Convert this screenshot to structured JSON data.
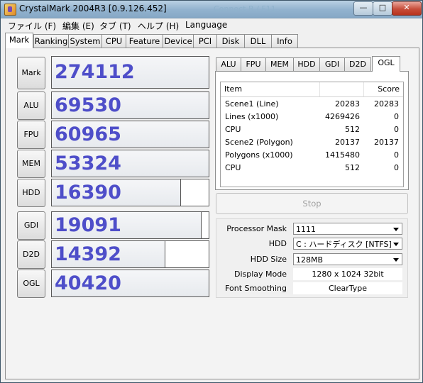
{
  "window": {
    "title": "CrystalMark 2004R3 [0.9.126.452]",
    "background_ghost_title": "Connect R / F11 ...",
    "min_glyph": "—",
    "max_glyph": "□",
    "close_glyph": "✕"
  },
  "menu": [
    "ファイル (F)",
    "編集 (E)",
    "タブ (T)",
    "ヘルプ (H)",
    "Language"
  ],
  "tabs": [
    "Mark",
    "Ranking",
    "System",
    "CPU",
    "Feature",
    "Device",
    "PCI",
    "Disk",
    "DLL",
    "Info"
  ],
  "active_tab": "Mark",
  "scores": {
    "mark": {
      "label": "Mark",
      "value": "274112",
      "fill": 1.0
    },
    "alu": {
      "label": "ALU",
      "value": "69530",
      "fill": 1.0
    },
    "fpu": {
      "label": "FPU",
      "value": "60965",
      "fill": 1.0
    },
    "mem": {
      "label": "MEM",
      "value": "53324",
      "fill": 1.0
    },
    "hdd": {
      "label": "HDD",
      "value": "16390",
      "fill": 0.82
    },
    "gdi": {
      "label": "GDI",
      "value": "19091",
      "fill": 0.95
    },
    "d2d": {
      "label": "D2D",
      "value": "14392",
      "fill": 0.72
    },
    "ogl": {
      "label": "OGL",
      "value": "40420",
      "fill": 1.0
    }
  },
  "subtabs": [
    "ALU",
    "FPU",
    "MEM",
    "HDD",
    "GDI",
    "D2D",
    "OGL"
  ],
  "active_subtab": "OGL",
  "results": {
    "columns": [
      "Item",
      "",
      "Score"
    ],
    "rows": [
      [
        "Scene1 (Line)",
        "20283",
        "20283"
      ],
      [
        "Lines (x1000)",
        "4269426",
        "0"
      ],
      [
        "CPU",
        "512",
        "0"
      ],
      [
        "Scene2 (Polygon)",
        "20137",
        "20137"
      ],
      [
        "Polygons (x1000)",
        "1415480",
        "0"
      ],
      [
        "CPU",
        "512",
        "0"
      ]
    ]
  },
  "stop_button": "Stop",
  "settings": {
    "processor_mask_label": "Processor Mask",
    "processor_mask_value": "1111",
    "hdd_label": "HDD",
    "hdd_value": "C : ハードディスク [NTFS]",
    "hdd_size_label": "HDD Size",
    "hdd_size_value": "128MB",
    "display_mode_label": "Display Mode",
    "display_mode_value": "1280 x 1024 32bit",
    "font_smoothing_label": "Font Smoothing",
    "font_smoothing_value": "ClearType"
  }
}
